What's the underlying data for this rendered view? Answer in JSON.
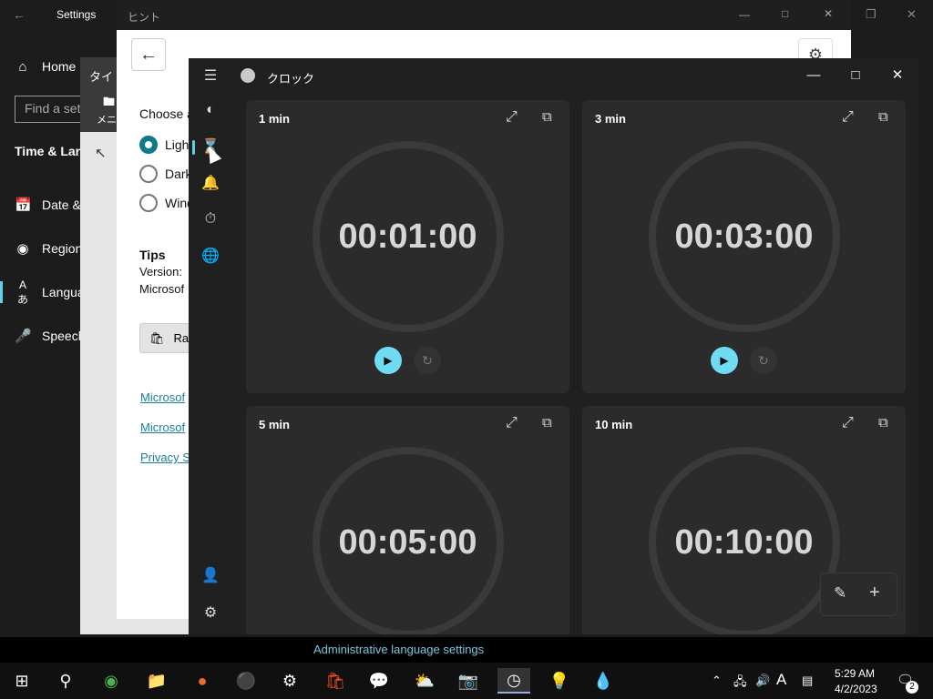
{
  "settings": {
    "title": "Settings",
    "home": "Home",
    "search_placeholder": "Find a set",
    "section": "Time & Lan",
    "nav": [
      "Date &",
      "Region",
      "Langua",
      "Speech"
    ],
    "admin_link": "Administrative language settings"
  },
  "jp_window": {
    "title": "タイト",
    "menu": "メニ"
  },
  "hint": {
    "title": "ヒント",
    "choose_label": "Choose a",
    "radios": [
      "Ligh",
      "Dark",
      "Wind"
    ],
    "tips_heading": "Tips",
    "version": "Version:",
    "microsoft": "Microsof",
    "store_button": "Ra",
    "links": [
      "Microsof",
      "Microsof",
      "Privacy S"
    ]
  },
  "clock": {
    "title": "クロック",
    "timers": [
      {
        "label": "1 min",
        "time": "00:01:00"
      },
      {
        "label": "3 min",
        "time": "00:03:00"
      },
      {
        "label": "5 min",
        "time": "00:05:00"
      },
      {
        "label": "10 min",
        "time": "00:10:00"
      }
    ]
  },
  "taskbar": {
    "time": "5:29 AM",
    "date": "4/2/2023",
    "notification_count": "2",
    "ime": "A"
  },
  "colors": {
    "accent": "#5ad2e8",
    "play": "#6fdcf4",
    "tile": "#2b2b2b",
    "clock_bg": "#202020"
  }
}
